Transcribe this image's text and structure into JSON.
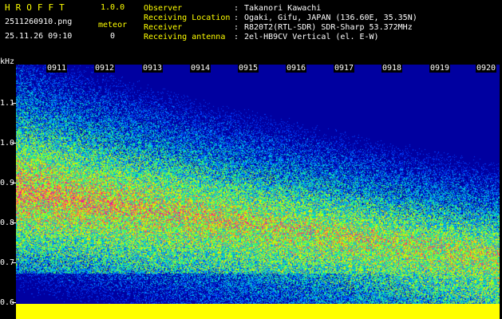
{
  "header": {
    "app_name": "HROFFT",
    "version": "1.0.0",
    "filename": "2511260910.png",
    "timestamp": "25.11.26 09:10",
    "meteor_label": "meteor",
    "meteor_count": "0",
    "fields": [
      {
        "label": "Observer",
        "sep": ":",
        "value": "Takanori Kawachi"
      },
      {
        "label": "Receiving Location",
        "sep": ":",
        "value": "Ogaki, Gifu, JAPAN (136.60E, 35.35N)"
      },
      {
        "label": "Receiver",
        "sep": ":",
        "value": "R820T2(RTL-SDR) SDR-Sharp 53.372MHz"
      },
      {
        "label": "Receiving antenna",
        "sep": ":",
        "value": "2el-HB9CV Vertical (el. E-W)"
      }
    ]
  },
  "plot": {
    "y_unit": "kHz",
    "y_ticks": [
      "1.1",
      "1.0",
      "0.9",
      "0.8",
      "0.7",
      "0.6"
    ],
    "time_labels": [
      "0911",
      "0912",
      "0913",
      "0914",
      "0915",
      "0916",
      "0917",
      "0918",
      "0919",
      "0920"
    ],
    "colors": {
      "baseline": "#ffff00",
      "palette": [
        "#0000a0",
        "#0040ff",
        "#00a0ff",
        "#00e0c0",
        "#40ff60",
        "#c0ff00",
        "#ffe000",
        "#ff4060",
        "#ff00a0"
      ]
    }
  }
}
